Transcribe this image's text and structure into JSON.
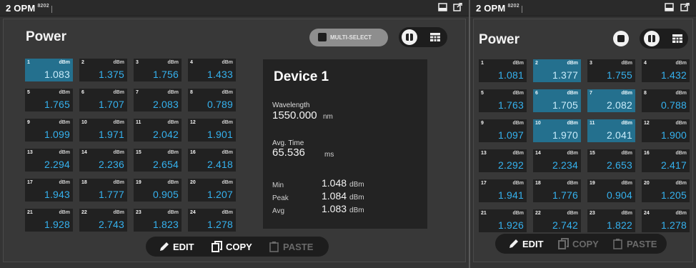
{
  "colors": {
    "value_text": "#35b2ef",
    "selected_tile": "#24708e",
    "tile_bg": "#212121"
  },
  "left": {
    "title": "2 OPM",
    "subtitle": "8202",
    "heading": "Power",
    "multi_select_label": "MULTI-SELECT",
    "unit": "dBm",
    "tiles": [
      {
        "n": "1",
        "v": "1.083",
        "selected": true
      },
      {
        "n": "2",
        "v": "1.375"
      },
      {
        "n": "3",
        "v": "1.756"
      },
      {
        "n": "4",
        "v": "1.433"
      },
      {
        "n": "5",
        "v": "1.765"
      },
      {
        "n": "6",
        "v": "1.707"
      },
      {
        "n": "7",
        "v": "2.083"
      },
      {
        "n": "8",
        "v": "0.789"
      },
      {
        "n": "9",
        "v": "1.099"
      },
      {
        "n": "10",
        "v": "1.971"
      },
      {
        "n": "11",
        "v": "2.042"
      },
      {
        "n": "12",
        "v": "1.901"
      },
      {
        "n": "13",
        "v": "2.294"
      },
      {
        "n": "14",
        "v": "2.236"
      },
      {
        "n": "15",
        "v": "2.654"
      },
      {
        "n": "16",
        "v": "2.418"
      },
      {
        "n": "17",
        "v": "1.943"
      },
      {
        "n": "18",
        "v": "1.777"
      },
      {
        "n": "19",
        "v": "0.905"
      },
      {
        "n": "20",
        "v": "1.207"
      },
      {
        "n": "21",
        "v": "1.928"
      },
      {
        "n": "22",
        "v": "2.743"
      },
      {
        "n": "23",
        "v": "1.823"
      },
      {
        "n": "24",
        "v": "1.278"
      }
    ],
    "device": {
      "title": "Device 1",
      "wavelength_label": "Wavelength",
      "wavelength_value": "1550.000",
      "wavelength_unit": "nm",
      "avg_time_label": "Avg. Time",
      "avg_time_value": "65.536",
      "avg_time_unit": "ms",
      "min_label": "Min",
      "min_value": "1.048",
      "min_unit": "dBm",
      "peak_label": "Peak",
      "peak_value": "1.084",
      "peak_unit": "dBm",
      "avg_label": "Avg",
      "avg_value": "1.083",
      "avg_unit": "dBm"
    },
    "toolbar": {
      "edit": "EDIT",
      "copy": "COPY",
      "paste": "PASTE"
    }
  },
  "right": {
    "title": "2 OPM",
    "subtitle": "8202",
    "heading": "Power",
    "unit": "dBm",
    "tiles": [
      {
        "n": "1",
        "v": "1.081"
      },
      {
        "n": "2",
        "v": "1.377",
        "selected": true
      },
      {
        "n": "3",
        "v": "1.755"
      },
      {
        "n": "4",
        "v": "1.432"
      },
      {
        "n": "5",
        "v": "1.763"
      },
      {
        "n": "6",
        "v": "1.705",
        "selected": true
      },
      {
        "n": "7",
        "v": "2.082",
        "selected": true
      },
      {
        "n": "8",
        "v": "0.788"
      },
      {
        "n": "9",
        "v": "1.097"
      },
      {
        "n": "10",
        "v": "1.970",
        "selected": true
      },
      {
        "n": "11",
        "v": "2.041",
        "selected": true
      },
      {
        "n": "12",
        "v": "1.900"
      },
      {
        "n": "13",
        "v": "2.292"
      },
      {
        "n": "14",
        "v": "2.234"
      },
      {
        "n": "15",
        "v": "2.653"
      },
      {
        "n": "16",
        "v": "2.417"
      },
      {
        "n": "17",
        "v": "1.941"
      },
      {
        "n": "18",
        "v": "1.776"
      },
      {
        "n": "19",
        "v": "0.904"
      },
      {
        "n": "20",
        "v": "1.205"
      },
      {
        "n": "21",
        "v": "1.926"
      },
      {
        "n": "22",
        "v": "2.742"
      },
      {
        "n": "23",
        "v": "1.822"
      },
      {
        "n": "24",
        "v": "1.278"
      }
    ],
    "toolbar": {
      "edit": "EDIT",
      "copy": "COPY",
      "paste": "PASTE"
    }
  }
}
